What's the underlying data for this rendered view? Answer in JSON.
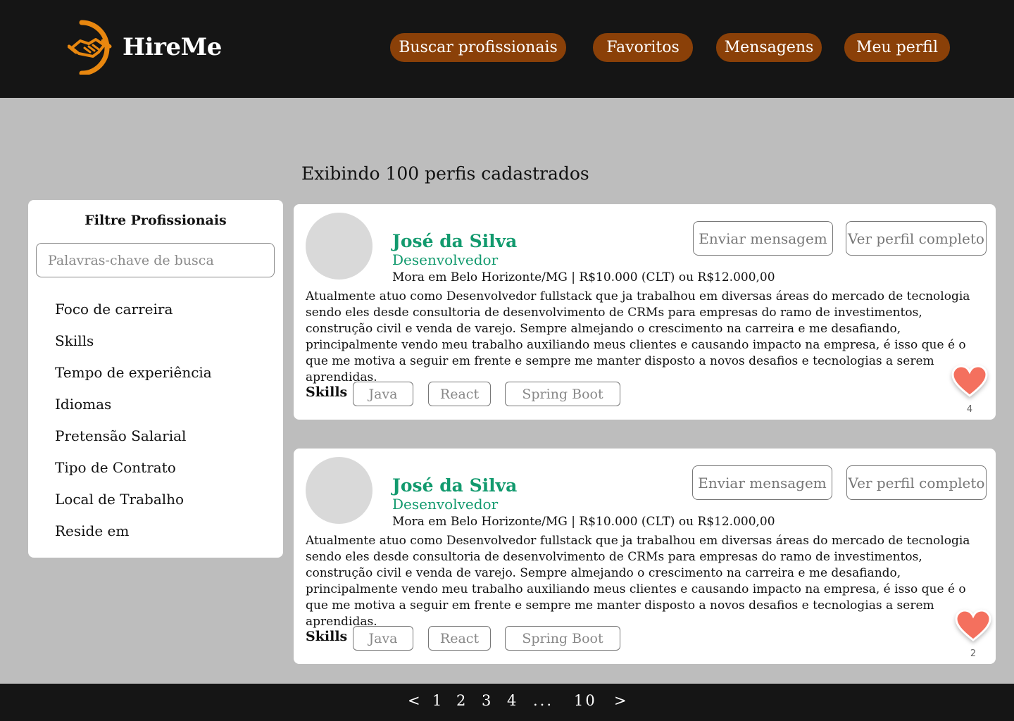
{
  "header": {
    "logo_text": "HireMe",
    "nav": [
      {
        "label": "Buscar profissionais"
      },
      {
        "label": "Favoritos"
      },
      {
        "label": "Mensagens"
      },
      {
        "label": "Meu perfil"
      }
    ]
  },
  "results_heading": "Exibindo 100 perfis cadastrados",
  "filters": {
    "title": "Filtre Profissionais",
    "search_placeholder": "Palavras-chave de busca",
    "items": [
      {
        "label": "Foco de carreira"
      },
      {
        "label": "Skills"
      },
      {
        "label": "Tempo de experiência"
      },
      {
        "label": "Idiomas"
      },
      {
        "label": "Pretensão Salarial"
      },
      {
        "label": "Tipo de Contrato"
      },
      {
        "label": "Local de Trabalho"
      },
      {
        "label": "Reside em"
      }
    ]
  },
  "profiles": [
    {
      "name": "José da Silva",
      "role": "Desenvolvedor",
      "location_salary": "Mora em Belo Horizonte/MG | R$10.000 (CLT) ou R$12.000,00",
      "description": "Atualmente atuo como Desenvolvedor fullstack que ja trabalhou em diversas áreas do mercado de tecnologia sendo eles desde consultoria de desenvolvimento de CRMs para empresas do ramo de investimentos, construção civil e venda de varejo. Sempre almejando o crescimento na carreira e me desafiando, principalmente vendo meu trabalho auxiliando meus clientes e causando impacto na empresa, é isso que é o que me motiva a seguir em frente e sempre me manter disposto a novos desafios e tecnologias a serem aprendidas.",
      "send_message_label": "Enviar mensagem",
      "view_profile_label": "Ver perfil completo",
      "skills_label": "Skills",
      "skills": [
        "Java",
        "React",
        "Spring Boot"
      ],
      "favorites_count": "4"
    },
    {
      "name": "José da Silva",
      "role": "Desenvolvedor",
      "location_salary": "Mora em Belo Horizonte/MG | R$10.000 (CLT) ou R$12.000,00",
      "description": "Atualmente atuo como Desenvolvedor fullstack que ja trabalhou em diversas áreas do mercado de tecnologia sendo eles desde consultoria de desenvolvimento de CRMs para empresas do ramo de investimentos, construção civil e venda de varejo. Sempre almejando o crescimento na carreira e me desafiando, principalmente vendo meu trabalho auxiliando meus clientes e causando impacto na empresa, é isso que é o que me motiva a seguir em frente e sempre me manter disposto a novos desafios e tecnologias a serem aprendidas.",
      "send_message_label": "Enviar mensagem",
      "view_profile_label": "Ver perfil completo",
      "skills_label": "Skills",
      "skills": [
        "Java",
        "React",
        "Spring Boot"
      ],
      "favorites_count": "2"
    }
  ],
  "pagination": {
    "prev": "<",
    "pages": [
      "1",
      "2",
      "3",
      "4"
    ],
    "ellipsis": "...",
    "last": "10",
    "next": ">"
  },
  "colors": {
    "header_bg": "#151515",
    "nav_button": "#8a4008",
    "accent_green": "#129a6e",
    "heart": "#f4705e",
    "logo_orange": "#e8870f"
  },
  "icons": {
    "logo": "handshake-logo-icon",
    "favorite": "heart-icon"
  }
}
